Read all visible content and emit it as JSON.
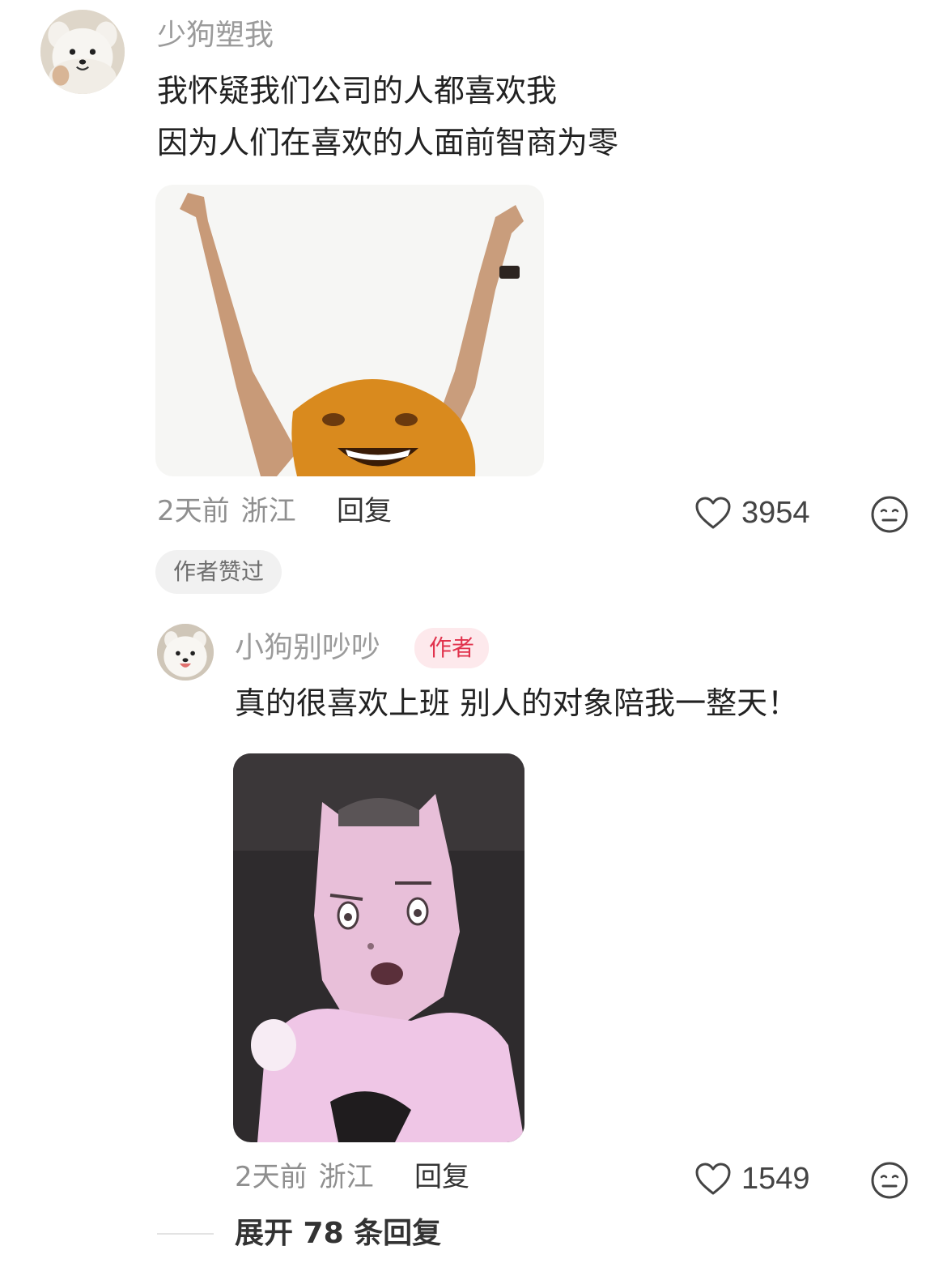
{
  "comments": [
    {
      "username": "少狗塑我",
      "lines": [
        "我怀疑我们公司的人都喜欢我",
        "因为人们在喜欢的人面前智商为零"
      ],
      "time": "2天前",
      "location": "浙江",
      "reply_label": "回复",
      "likes": "3954",
      "pill": "作者赞过",
      "avatar_icon": "samoyed-avatar",
      "sticker_icon": "orange-cheering-sticker"
    }
  ],
  "reply": {
    "username": "小狗别吵吵",
    "author_tag": "作者",
    "text": "真的很喜欢上班 别人的对象陪我一整天！",
    "time": "2天前",
    "location": "浙江",
    "reply_label": "回复",
    "likes": "1549",
    "avatar_icon": "samoyed-avatar",
    "sticker_icon": "pink-cat-sticker"
  },
  "expand_replies": "展开 78 条回复",
  "colors": {
    "username": "#9b9b9b",
    "text": "#222222",
    "meta": "#8f8f8f",
    "author_tag_bg": "#fde9ec",
    "author_tag_fg": "#e1334d",
    "pill_bg": "#f1f1f1"
  }
}
